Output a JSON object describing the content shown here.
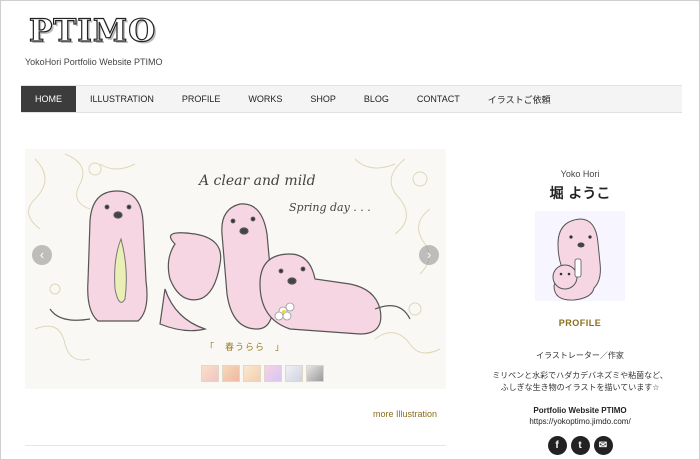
{
  "header": {
    "logo": "PTIMO",
    "tagline": "YokoHori Portfolio Website PTIMO"
  },
  "nav": {
    "items": [
      {
        "label": "HOME",
        "active": true
      },
      {
        "label": "ILLUSTRATION"
      },
      {
        "label": "PROFILE"
      },
      {
        "label": "WORKS"
      },
      {
        "label": "SHOP"
      },
      {
        "label": "BLOG"
      },
      {
        "label": "CONTACT"
      },
      {
        "label": "イラストご依頼"
      }
    ]
  },
  "slider": {
    "text_line1": "A clear and mild",
    "text_line2": "Spring day . . .",
    "caption": "「　春うらら　」",
    "prev_icon": "chevron-left-icon",
    "next_icon": "chevron-right-icon",
    "thumb_count": 6
  },
  "more_link": "more Illustration",
  "sidebar": {
    "name_en": "Yoko Hori",
    "name_jp": "堀 ようこ",
    "profile_title": "PROFILE",
    "role": "イラストレーター／作家",
    "desc_line1": "ミリペンと水彩でハダカデバネズミや粘菌など、",
    "desc_line2": "ふしぎな生き物のイラストを描いています☆",
    "site_title": "Portfolio Website PTIMO",
    "site_url": "https://yokoptimo.jimdo.com/",
    "social": [
      {
        "icon": "facebook-icon",
        "glyph": "f"
      },
      {
        "icon": "twitter-icon",
        "glyph": "t"
      },
      {
        "icon": "mail-icon",
        "glyph": "✉"
      }
    ]
  },
  "colors": {
    "accent_gold": "#8a6d1d",
    "nav_active": "#3c3c3c",
    "otter_pink": "#f6d6e2"
  }
}
